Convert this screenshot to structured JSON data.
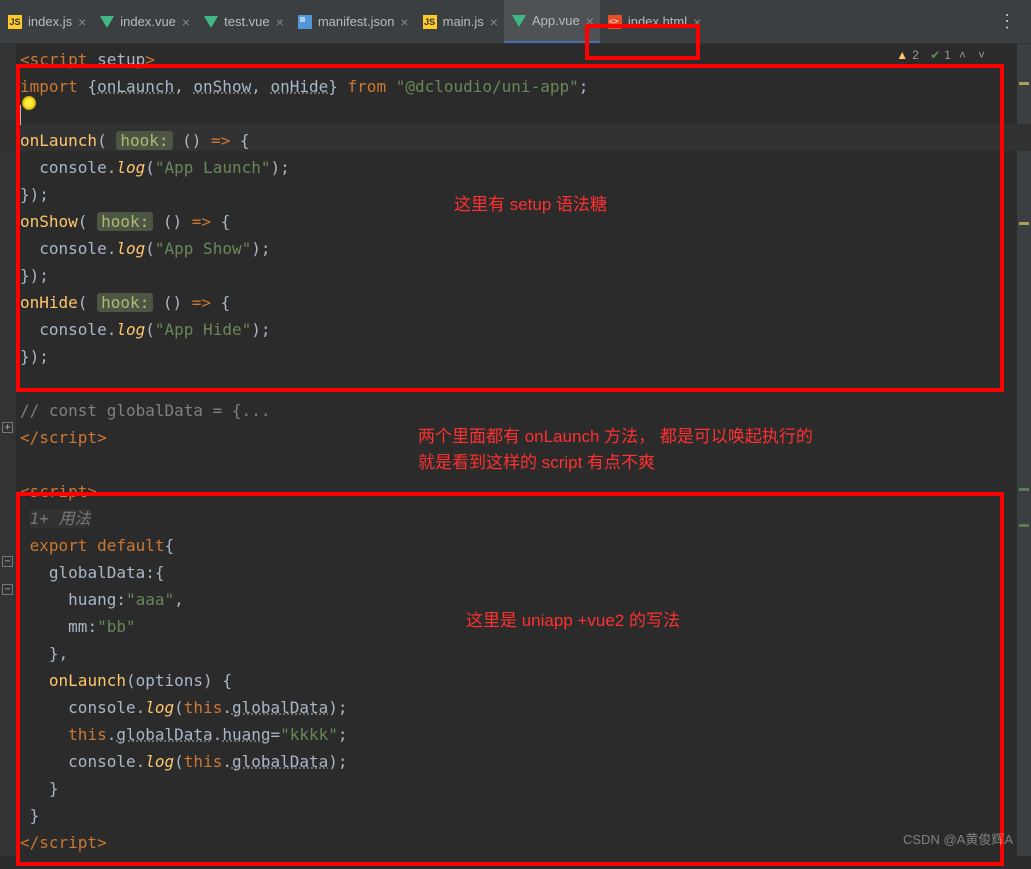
{
  "tabs": [
    {
      "label": "index.js",
      "icon": "js"
    },
    {
      "label": "index.vue",
      "icon": "vue"
    },
    {
      "label": "test.vue",
      "icon": "vue"
    },
    {
      "label": "manifest.json",
      "icon": "json"
    },
    {
      "label": "main.js",
      "icon": "js"
    },
    {
      "label": "App.vue",
      "icon": "vue",
      "active": true
    },
    {
      "label": "index.html",
      "icon": "html"
    }
  ],
  "problems": {
    "warnings": "2",
    "passes": "1"
  },
  "anno1": "这里有 setup 语法糖",
  "anno2_l1": "两个里面都有 onLaunch 方法， 都是可以唤起执行的",
  "anno2_l2": "就是看到这样的 script 有点不爽",
  "anno3": "这里是 uniapp +vue2 的写法",
  "comment_folded": "// const globalData = {...",
  "usages_hint": "1+ 用法",
  "hook_label": "hook:",
  "code_block1": {
    "script_tag_open": [
      "<",
      "script",
      " setup",
      ">"
    ],
    "import_line": {
      "kw": "import ",
      "names": [
        "onLaunch",
        "onShow",
        "onHide"
      ],
      "from": " from ",
      "pkg": "\"@dcloudio/uni-app\"",
      "end": ";"
    },
    "calls": [
      {
        "fn": "onLaunch",
        "log": "\"App Launch\""
      },
      {
        "fn": "onShow",
        "log": "\"App Show\""
      },
      {
        "fn": "onHide",
        "log": "\"App Hide\""
      }
    ]
  },
  "script_close": [
    "</",
    "script",
    ">"
  ],
  "code_block2": {
    "script_tag_open": [
      "<",
      "script",
      ">"
    ],
    "export_kw": "export ",
    "default_kw": "default",
    "globalData_key": "globalData",
    "huang_key": "huang",
    "huang_val": "\"aaa\"",
    "mm_key": "mm",
    "mm_val": "\"bb\"",
    "onLaunch_key": "onLaunch",
    "options_param": "options",
    "console": "console",
    "log": "log",
    "this": "this",
    "globalDataRef": "globalData",
    "huang_assign": "huang",
    "kkkk": "\"kkkk\""
  },
  "watermark": "CSDN @A黄俊辉A"
}
